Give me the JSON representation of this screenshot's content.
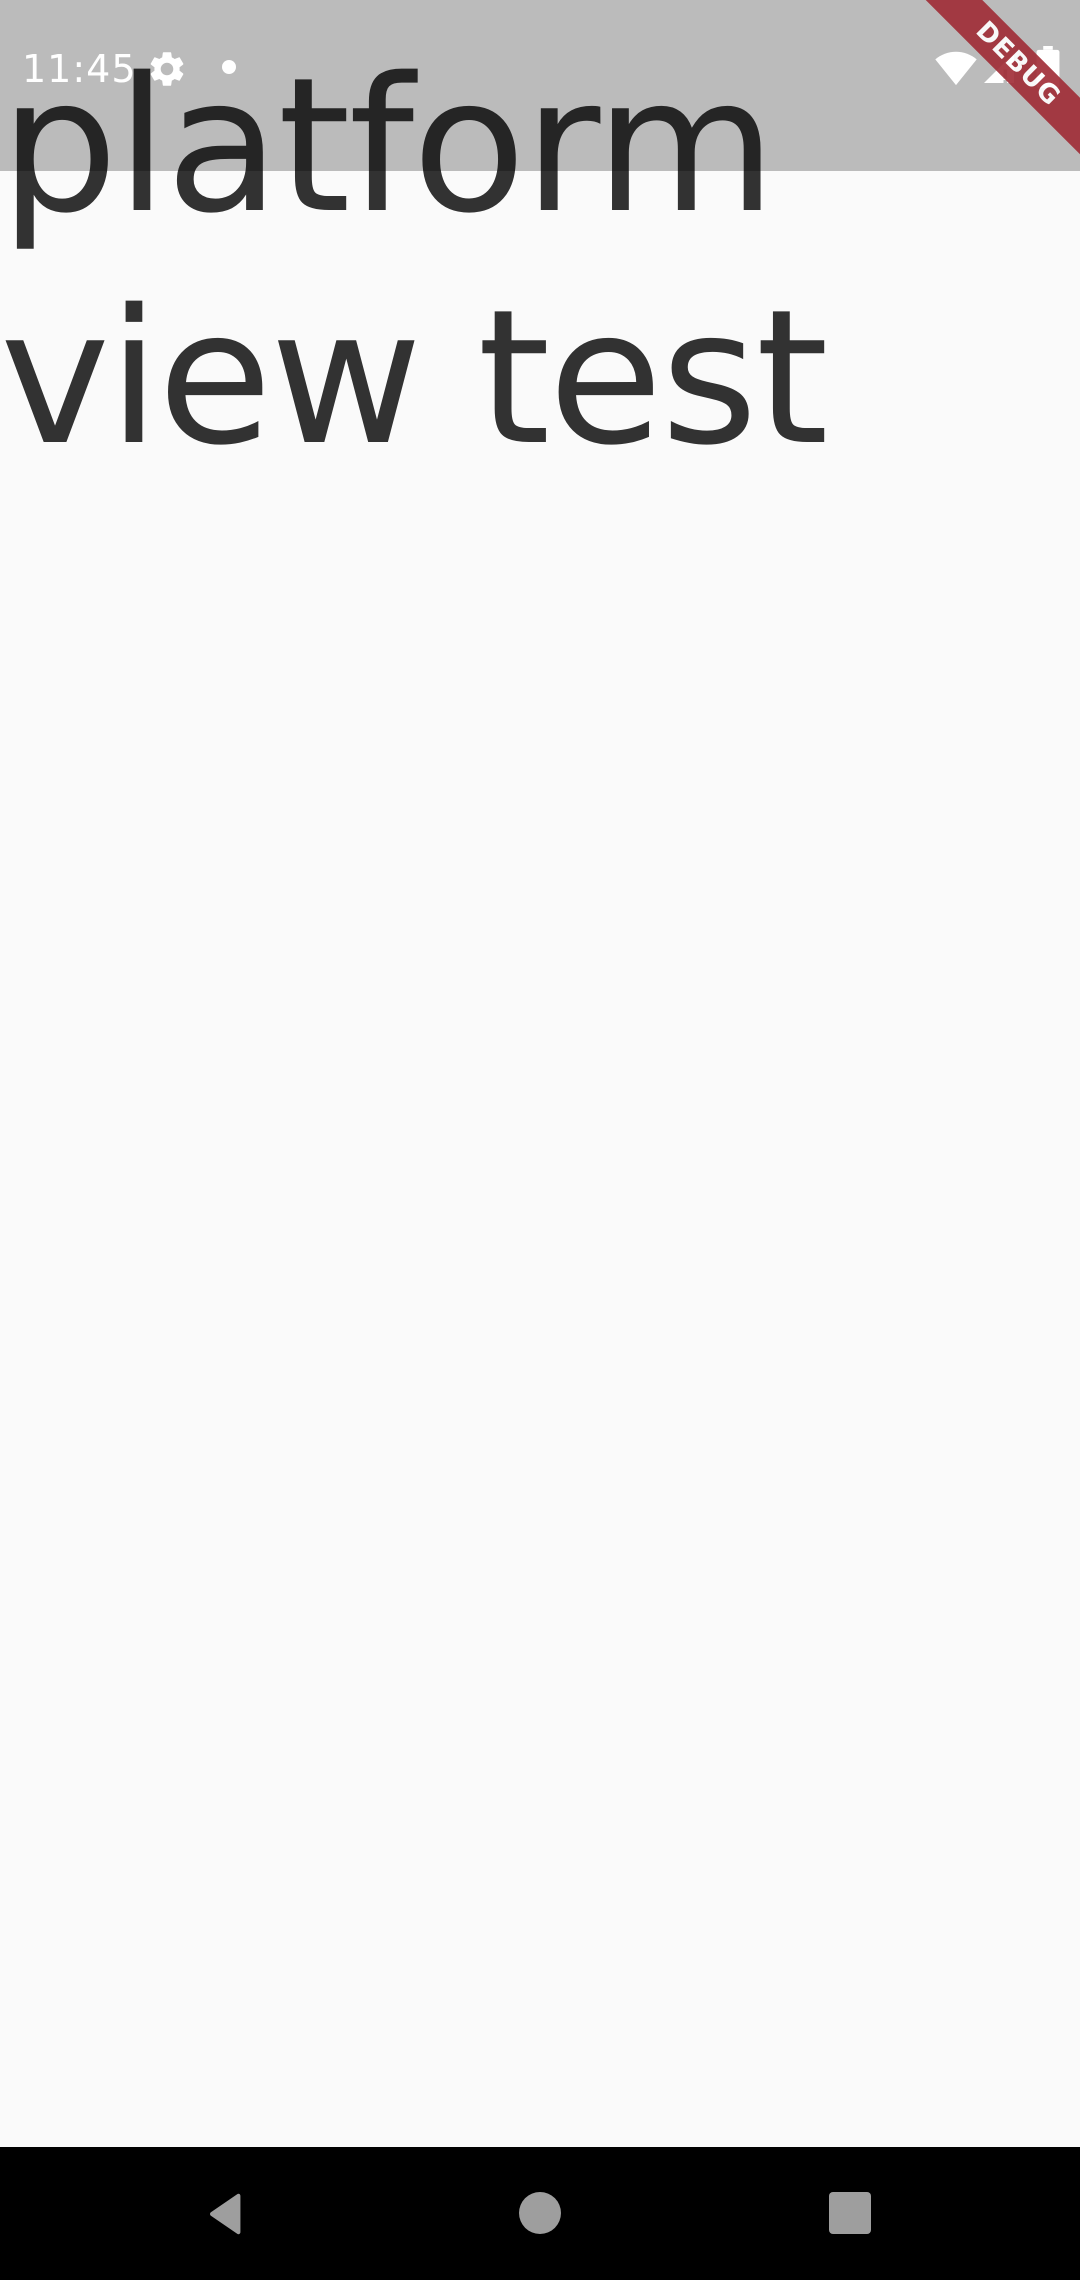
{
  "status_bar": {
    "time": "11:45",
    "icons": [
      "gear-icon",
      "notification-dot",
      "wifi-icon",
      "signal-icon",
      "battery-icon"
    ],
    "background_color": "#bbbbbb"
  },
  "main": {
    "text": "platform view test"
  },
  "debug_banner": {
    "label": "DEBUG",
    "color": "#a02b35"
  },
  "nav_bar": {
    "icons": [
      "back-icon",
      "home-icon",
      "recents-icon"
    ]
  }
}
